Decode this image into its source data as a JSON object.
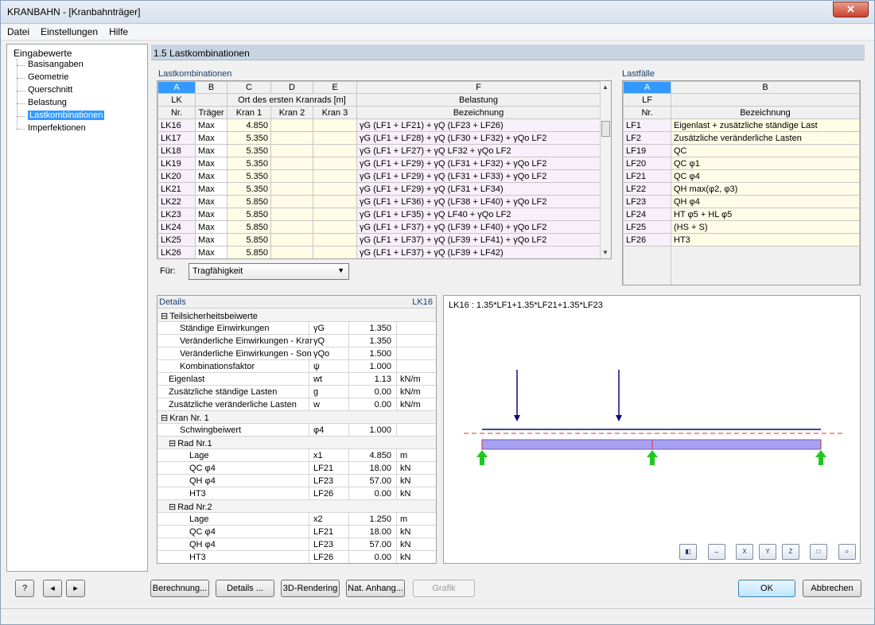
{
  "window": {
    "title": "KRANBAHN - [Kranbahnträger]",
    "close": "✕"
  },
  "menu": [
    "Datei",
    "Einstellungen",
    "Hilfe"
  ],
  "nav": {
    "root": "Eingabewerte",
    "items": [
      "Basisangaben",
      "Geometrie",
      "Querschnitt",
      "Belastung",
      "Lastkombinationen",
      "Imperfektionen"
    ],
    "selected": "Lastkombinationen"
  },
  "page_title": "1.5 Lastkombinationen",
  "lk_table": {
    "group_label": "Lastkombinationen",
    "columns": [
      "A",
      "B",
      "C",
      "D",
      "E",
      "F"
    ],
    "head1": [
      "LK",
      "",
      "Ort des ersten Kranrads [m]",
      "Belastung"
    ],
    "head2": [
      "Nr.",
      "Träger",
      "Kran 1",
      "Kran 2",
      "Kran 3",
      "Bezeichnung"
    ],
    "rows": [
      {
        "nr": "LK16",
        "traeger": "Max",
        "k1": "4.850",
        "k2": "",
        "k3": "",
        "bez": "γG (LF1 + LF21) + γQ (LF23 + LF26)"
      },
      {
        "nr": "LK17",
        "traeger": "Max",
        "k1": "5.350",
        "k2": "",
        "k3": "",
        "bez": "γG (LF1 + LF28) + γQ (LF30 + LF32) + γQo LF2"
      },
      {
        "nr": "LK18",
        "traeger": "Max",
        "k1": "5.350",
        "k2": "",
        "k3": "",
        "bez": "γG (LF1 + LF27) + γQ LF32 + γQo LF2"
      },
      {
        "nr": "LK19",
        "traeger": "Max",
        "k1": "5.350",
        "k2": "",
        "k3": "",
        "bez": "γG (LF1 + LF29) + γQ (LF31 + LF32) + γQo LF2"
      },
      {
        "nr": "LK20",
        "traeger": "Max",
        "k1": "5.350",
        "k2": "",
        "k3": "",
        "bez": "γG (LF1 + LF29) + γQ (LF31 + LF33) + γQo LF2"
      },
      {
        "nr": "LK21",
        "traeger": "Max",
        "k1": "5.350",
        "k2": "",
        "k3": "",
        "bez": "γG (LF1 + LF29) + γQ (LF31 + LF34)"
      },
      {
        "nr": "LK22",
        "traeger": "Max",
        "k1": "5.850",
        "k2": "",
        "k3": "",
        "bez": "γG (LF1 + LF36) + γQ (LF38 + LF40) + γQo LF2"
      },
      {
        "nr": "LK23",
        "traeger": "Max",
        "k1": "5.850",
        "k2": "",
        "k3": "",
        "bez": "γG (LF1 + LF35) + γQ LF40 + γQo LF2"
      },
      {
        "nr": "LK24",
        "traeger": "Max",
        "k1": "5.850",
        "k2": "",
        "k3": "",
        "bez": "γG (LF1 + LF37) + γQ (LF39 + LF40) + γQo LF2"
      },
      {
        "nr": "LK25",
        "traeger": "Max",
        "k1": "5.850",
        "k2": "",
        "k3": "",
        "bez": "γG (LF1 + LF37) + γQ (LF39 + LF41) + γQo LF2"
      },
      {
        "nr": "LK26",
        "traeger": "Max",
        "k1": "5.850",
        "k2": "",
        "k3": "",
        "bez": "γG (LF1 + LF37) + γQ (LF39 + LF42)"
      }
    ]
  },
  "lf_table": {
    "group_label": "Lastfälle",
    "columns": [
      "A",
      "B"
    ],
    "head1": [
      "LF",
      ""
    ],
    "head2": [
      "Nr.",
      "Bezeichnung"
    ],
    "rows": [
      {
        "nr": "LF1",
        "bez": "Eigenlast + zusätzliche ständige Last"
      },
      {
        "nr": "LF2",
        "bez": "Zusätzliche veränderliche Lasten"
      },
      {
        "nr": "LF19",
        "bez": "QC"
      },
      {
        "nr": "LF20",
        "bez": "QC φ1"
      },
      {
        "nr": "LF21",
        "bez": "QC φ4"
      },
      {
        "nr": "LF22",
        "bez": "QH max(φ2, φ3)"
      },
      {
        "nr": "LF23",
        "bez": "QH φ4"
      },
      {
        "nr": "LF24",
        "bez": "HT φ5 + HL φ5"
      },
      {
        "nr": "LF25",
        "bez": "(HS + S)"
      },
      {
        "nr": "LF26",
        "bez": "HT3"
      }
    ]
  },
  "fuer": {
    "label": "Für:",
    "value": "Tragfähigkeit"
  },
  "details": {
    "title": "Details",
    "current": "LK16",
    "rows": [
      {
        "indent": 0,
        "group": true,
        "label": "Teilsicherheitsbeiwerte",
        "sym": "",
        "val": "",
        "unit": ""
      },
      {
        "indent": 2,
        "label": "Ständige Einwirkungen",
        "sym": "γG",
        "val": "1.350",
        "unit": ""
      },
      {
        "indent": 2,
        "label": "Veränderliche Einwirkungen - Krar",
        "sym": "γQ",
        "val": "1.350",
        "unit": ""
      },
      {
        "indent": 2,
        "label": "Veränderliche Einwirkungen - Son",
        "sym": "γQo",
        "val": "1.500",
        "unit": ""
      },
      {
        "indent": 2,
        "label": "Kombinationsfaktor",
        "sym": "ψ",
        "val": "1.000",
        "unit": ""
      },
      {
        "indent": 1,
        "label": "Eigenlast",
        "sym": "wt",
        "val": "1.13",
        "unit": "kN/m"
      },
      {
        "indent": 1,
        "label": "Zusätzliche ständige Lasten",
        "sym": "g",
        "val": "0.00",
        "unit": "kN/m"
      },
      {
        "indent": 1,
        "label": "Zusätzliche veränderliche Lasten",
        "sym": "w",
        "val": "0.00",
        "unit": "kN/m"
      },
      {
        "indent": 0,
        "group": true,
        "label": "Kran Nr. 1",
        "sym": "",
        "val": "",
        "unit": ""
      },
      {
        "indent": 2,
        "label": "Schwingbeiwert",
        "sym": "φ4",
        "val": "1.000",
        "unit": ""
      },
      {
        "indent": 1,
        "group": true,
        "label": "Rad Nr.1",
        "sym": "",
        "val": "",
        "unit": ""
      },
      {
        "indent": 3,
        "label": "Lage",
        "sym": "x1",
        "val": "4.850",
        "unit": "m"
      },
      {
        "indent": 3,
        "label": "QC φ4",
        "sym": "LF21",
        "val": "18.00",
        "unit": "kN"
      },
      {
        "indent": 3,
        "label": "QH φ4",
        "sym": "LF23",
        "val": "57.00",
        "unit": "kN"
      },
      {
        "indent": 3,
        "label": "HT3",
        "sym": "LF26",
        "val": "0.00",
        "unit": "kN"
      },
      {
        "indent": 1,
        "group": true,
        "label": "Rad Nr.2",
        "sym": "",
        "val": "",
        "unit": ""
      },
      {
        "indent": 3,
        "label": "Lage",
        "sym": "x2",
        "val": "1.250",
        "unit": "m"
      },
      {
        "indent": 3,
        "label": "QC φ4",
        "sym": "LF21",
        "val": "18.00",
        "unit": "kN"
      },
      {
        "indent": 3,
        "label": "QH φ4",
        "sym": "LF23",
        "val": "57.00",
        "unit": "kN"
      },
      {
        "indent": 3,
        "label": "HT3",
        "sym": "LF26",
        "val": "0.00",
        "unit": "kN"
      }
    ]
  },
  "graphic": {
    "caption": "LK16 : 1.35*LF1+1.35*LF21+1.35*LF23"
  },
  "graphic_tools": [
    "view-icon",
    "dimension-icon",
    "view-x-icon",
    "view-y-icon",
    "view-z-icon",
    "iso-view-icon",
    "zoom-icon"
  ],
  "buttons": {
    "berechnung": "Berechnung...",
    "details": "Details ...",
    "rendering": "3D-Rendering",
    "nat_anhang": "Nat. Anhang...",
    "grafik": "Grafik",
    "ok": "OK",
    "abbrechen": "Abbrechen"
  },
  "colors": {
    "selection": "#3399ff",
    "beam": "#a8a0f0",
    "load_arrow": "#0a0a78",
    "support": "#1ec81e"
  }
}
